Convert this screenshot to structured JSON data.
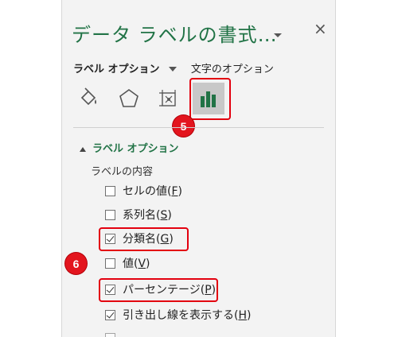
{
  "pane": {
    "title": "データ ラベルの書式…",
    "close_glyph": "×"
  },
  "option_tabs": {
    "label_options": "ラベル オプション",
    "text_options": "文字のオプション"
  },
  "icon_tabs": [
    {
      "name": "fill-line-icon",
      "active": false
    },
    {
      "name": "effects-icon",
      "active": false
    },
    {
      "name": "size-properties-icon",
      "active": false
    },
    {
      "name": "label-options-icon",
      "active": true
    }
  ],
  "callouts": {
    "step5": "5",
    "step6": "6"
  },
  "section": {
    "title": "ラベル オプション",
    "subheading": "ラベルの内容"
  },
  "checkboxes": [
    {
      "prefix": "セルの値(",
      "key": "F",
      "suffix": ")",
      "checked": false
    },
    {
      "prefix": "系列名(",
      "key": "S",
      "suffix": ")",
      "checked": false
    },
    {
      "prefix": "分類名(",
      "key": "G",
      "suffix": ")",
      "checked": true
    },
    {
      "prefix": "値(",
      "key": "V",
      "suffix": ")",
      "checked": false
    },
    {
      "prefix": "パーセンテージ(",
      "key": "P",
      "suffix": ")",
      "checked": true
    },
    {
      "prefix": "引き出し線を表示する(",
      "key": "H",
      "suffix": ")",
      "checked": true
    }
  ],
  "colors": {
    "accent_green": "#217346",
    "highlight_red": "#e3000f"
  }
}
